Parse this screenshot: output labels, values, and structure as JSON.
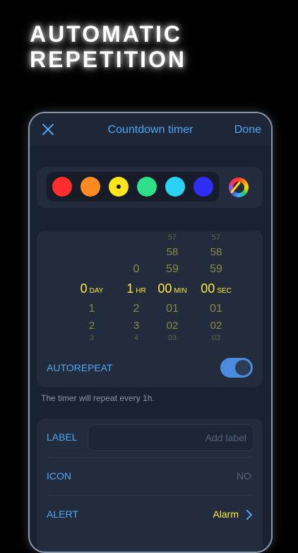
{
  "headline": {
    "line1": "AUTOMATIC",
    "line2": "REPETITION"
  },
  "navbar": {
    "title": "Countdown timer",
    "done_label": "Done",
    "close_icon": "close-icon"
  },
  "colors": {
    "swatches": [
      "#ff2d2d",
      "#ff8a22",
      "#ffe51a",
      "#2ee08a",
      "#2ad2f5",
      "#2f2cf5"
    ],
    "selected_index": 2,
    "custom_icon": "color-wheel-icon"
  },
  "picker": {
    "day": {
      "above": [
        "",
        "",
        ""
      ],
      "value": "0",
      "unit": "DAY",
      "below": [
        "1",
        "2",
        "3"
      ]
    },
    "hour": {
      "above": [
        "",
        "",
        "0"
      ],
      "value": "1",
      "unit": "HR",
      "below": [
        "2",
        "3",
        "4"
      ]
    },
    "min": {
      "above": [
        "57",
        "58",
        "59"
      ],
      "value": "00",
      "unit": "MIN",
      "below": [
        "01",
        "02",
        "03"
      ]
    },
    "sec": {
      "above": [
        "57",
        "58",
        "59"
      ],
      "value": "00",
      "unit": "SEC",
      "below": [
        "01",
        "02",
        "03"
      ]
    }
  },
  "autorepeat": {
    "label": "AUTOREPEAT",
    "enabled": true,
    "hint": "The timer will repeat every 1h."
  },
  "settings": {
    "label_row": {
      "label": "LABEL",
      "placeholder": "Add label"
    },
    "icon_row": {
      "label": "ICON",
      "value": "NO"
    },
    "alert_row": {
      "label": "ALERT",
      "value": "Alarm"
    }
  },
  "accent_color": "#4fa6f5",
  "highlight_color": "#ffe83a"
}
